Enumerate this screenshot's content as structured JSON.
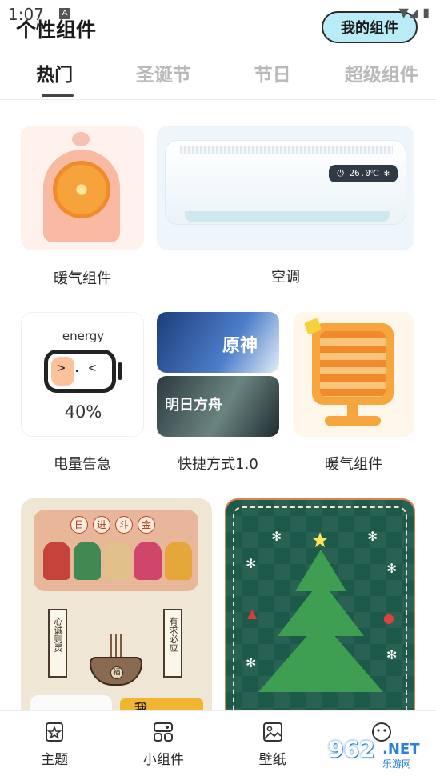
{
  "status": {
    "time": "1:07",
    "a_badge": "A",
    "right_icons": "▼◢ ▮"
  },
  "header": {
    "title": "个性组件",
    "my_widgets": "我的组件"
  },
  "tabs": [
    {
      "label": "热门",
      "active": true
    },
    {
      "label": "圣诞节",
      "active": false
    },
    {
      "label": "节日",
      "active": false
    },
    {
      "label": "超级组件",
      "active": false
    }
  ],
  "widgets": {
    "heater1": {
      "label": "暖气组件"
    },
    "ac": {
      "label": "空调",
      "display": "⏻ 26.0℃ ✻"
    },
    "battery": {
      "label": "电量告急",
      "energy_text": "energy",
      "percent": "40%",
      "level": 0.4,
      "face": ">  .  <"
    },
    "shortcut": {
      "label": "快捷方式1.0",
      "game1": "原神",
      "game2": "明日方舟"
    },
    "heater2": {
      "label": "暖气组件"
    },
    "fortune": {
      "chars": [
        "日",
        "进",
        "斗",
        "金"
      ],
      "scroll_left": "心诚则灵",
      "scroll_right": "有求必应",
      "censer_char": "福",
      "bottom_text": "我"
    }
  },
  "bottom_nav": [
    {
      "label": "主题",
      "icon": "star-frame-icon"
    },
    {
      "label": "小组件",
      "icon": "widgets-icon"
    },
    {
      "label": "壁纸",
      "icon": "image-icon"
    },
    {
      "label": "",
      "icon": "profile-face-icon"
    }
  ],
  "watermark": {
    "num": "962",
    "net": ".NET",
    "sub": "乐游网"
  },
  "colors": {
    "accent_tab": "#222222",
    "inactive_tab": "#b9b9b9",
    "my_widgets_bg": "#b8ecf6",
    "xmas_bg": "#1d5a4a"
  }
}
